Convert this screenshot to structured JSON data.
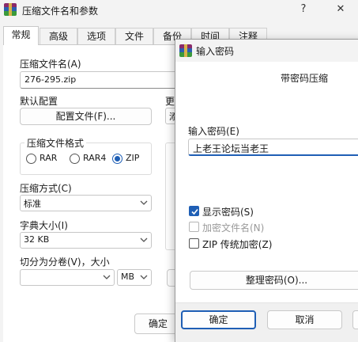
{
  "main_window": {
    "title": "压缩文件名和参数",
    "help_button": "?",
    "close_button": "✕",
    "tabs": [
      "常规",
      "高级",
      "选项",
      "文件",
      "备份",
      "时间",
      "注释"
    ],
    "archive_name_label": "压缩文件名(A)",
    "archive_name_value": "276-295.zip",
    "default_profile_label": "默认配置",
    "profile_button": "配置文件(F)...",
    "update_mode_label_partial": "更",
    "update_mode_value_partial": "添",
    "format_group_label": "压缩文件格式",
    "format_options": [
      "RAR",
      "RAR4",
      "ZIP"
    ],
    "format_selected": "ZIP",
    "method_label": "压缩方式(C)",
    "method_value": "标准",
    "dict_label": "字典大小(I)",
    "dict_value": "32 KB",
    "split_label": "切分为分卷(V)，大小",
    "split_value": "",
    "split_unit": "MB",
    "ok_button_partial": "确定"
  },
  "dialog": {
    "title": "输入密码",
    "heading": "带密码压缩",
    "password_label": "输入密码(E)",
    "password_value": "上老王论坛当老王",
    "show_password_label": "显示密码(S)",
    "show_password_checked": true,
    "encrypt_names_label": "加密文件名(N)",
    "encrypt_names_checked": false,
    "zip_legacy_label": "ZIP 传统加密(Z)",
    "zip_legacy_checked": false,
    "organize_button": "整理密码(O)...",
    "ok_button": "确定",
    "cancel_button": "取消"
  }
}
